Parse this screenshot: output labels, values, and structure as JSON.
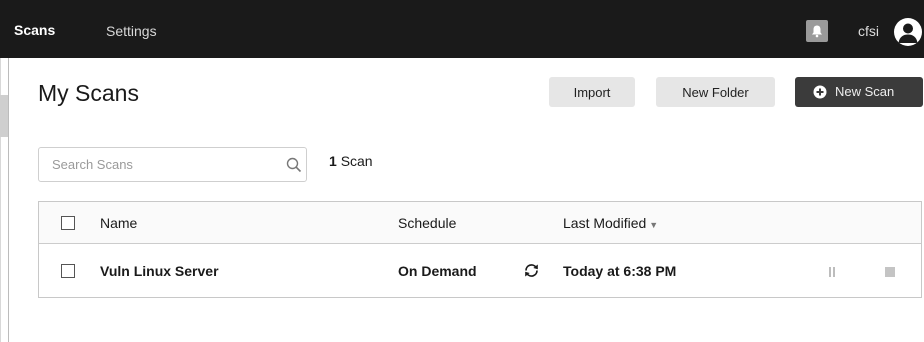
{
  "nav": {
    "scans": "Scans",
    "settings": "Settings",
    "username": "cfsi"
  },
  "page": {
    "title": "My Scans"
  },
  "toolbar": {
    "import": "Import",
    "new_folder": "New Folder",
    "new_scan": "New Scan"
  },
  "search": {
    "placeholder": "Search Scans",
    "count_number": "1",
    "count_label": "Scan"
  },
  "table": {
    "columns": {
      "name": "Name",
      "schedule": "Schedule",
      "last_modified": "Last Modified"
    },
    "sort_indicator": "▼",
    "rows": [
      {
        "name": "Vuln Linux Server",
        "schedule": "On Demand",
        "last_modified": "Today at 6:38 PM"
      }
    ]
  },
  "icons": {
    "bell": "bell-icon",
    "avatar": "user-icon",
    "new_scan": "plus-circle-icon",
    "search": "search-icon",
    "refresh": "refresh-icon",
    "pause": "pause-icon",
    "stop": "stop-icon"
  },
  "colors": {
    "topbar": "#1a1a1a",
    "primary_button": "#3b3b3b",
    "secondary_button": "#e6e6e6"
  }
}
